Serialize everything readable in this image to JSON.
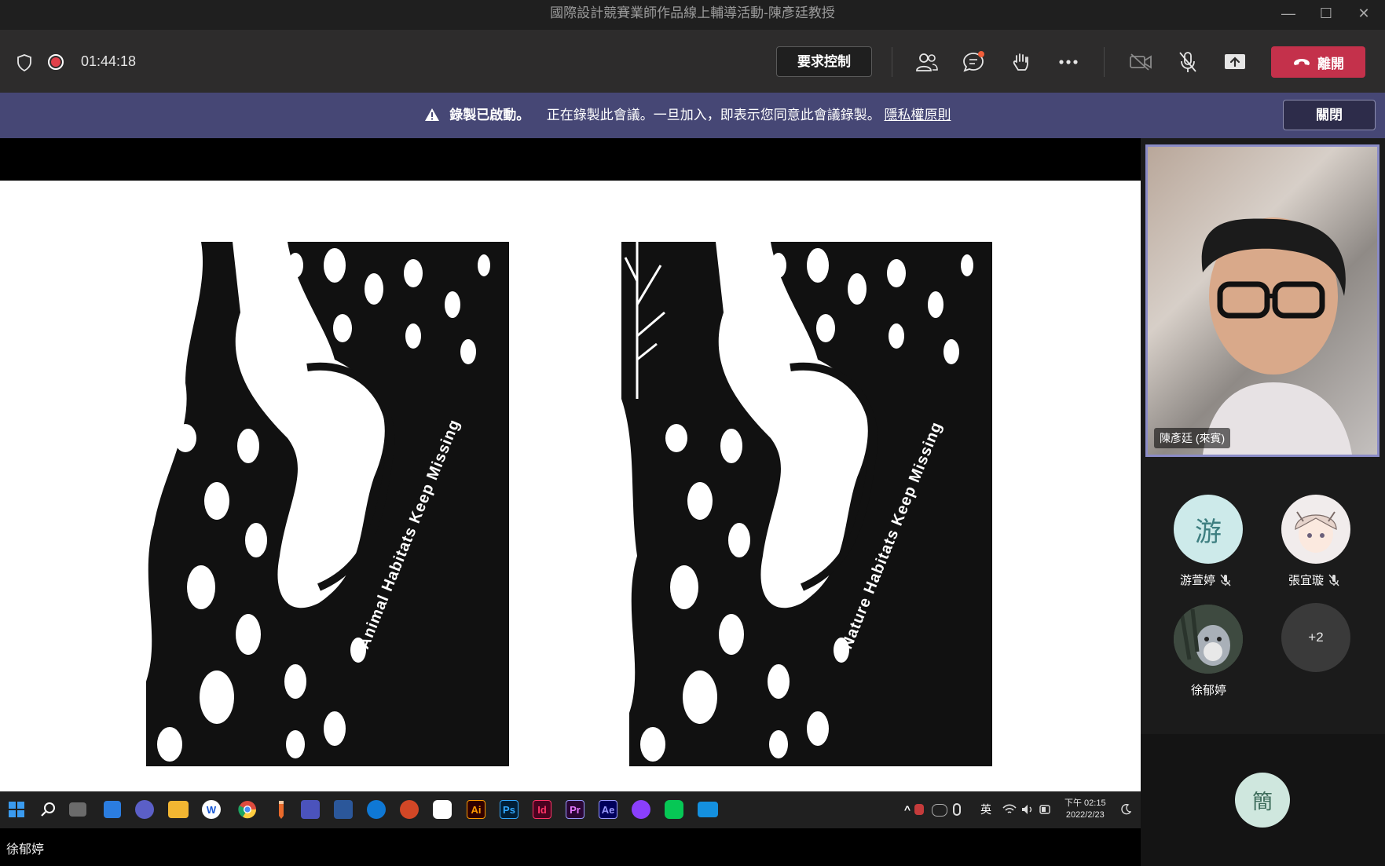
{
  "window": {
    "title": "國際設計競賽業師作品線上輔導活動-陳彥廷教授",
    "minimize": "—",
    "maximize": "☐",
    "close": "✕"
  },
  "toolbar": {
    "timer": "01:44:18",
    "request_control": "要求控制",
    "leave": "離開"
  },
  "banner": {
    "bold": "錄製已啟動。",
    "message": "正在錄製此會議。一旦加入，即表示您同意此會議錄製。",
    "link": "隱私權原則",
    "close": "關閉"
  },
  "slide": {
    "poster_left_text": "Animal Habitats Keep Missing",
    "poster_right_text": "Nature Habitats Keep Missing"
  },
  "participants": {
    "presenter": {
      "name": "陳彥廷 (來賓)"
    },
    "list": [
      {
        "name": "游萱婷",
        "initial": "游",
        "muted": true
      },
      {
        "name": "張宜璇",
        "initial": "",
        "muted": true
      },
      {
        "name": "徐郁婷",
        "initial": "",
        "muted": false
      }
    ],
    "more": "+2",
    "self_initial": "簡"
  },
  "taskbar": {
    "apps": [
      "W",
      "Ai",
      "Ps",
      "Id",
      "Pr",
      "Ae"
    ],
    "ime": "英",
    "time": "下午 02:15",
    "date": "2022/2/23"
  },
  "shared_screen_owner": "徐郁婷",
  "colors": {
    "accent": "#464775",
    "leave": "#c4314b",
    "record": "#e0404a",
    "selection": "#8b8cc7"
  }
}
